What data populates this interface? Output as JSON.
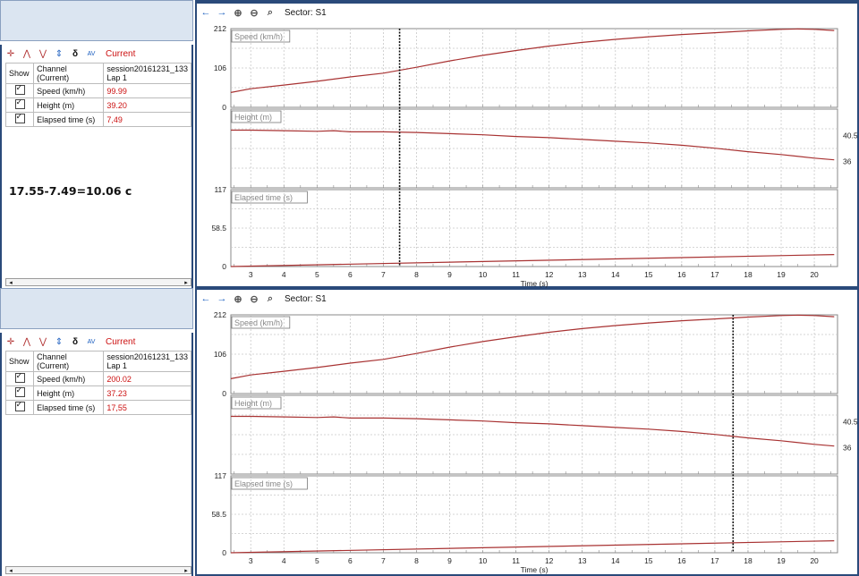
{
  "panels": [
    {
      "toolbar": {
        "current_label": "Current"
      },
      "table": {
        "header_show": "Show",
        "header_channel": "Channel\n(Current)",
        "header_session": "session20161231_133\nLap 1",
        "rows": [
          {
            "channel": "Speed (km/h)",
            "value": "99.99"
          },
          {
            "channel": "Height (m)",
            "value": "39.20"
          },
          {
            "channel": "Elapsed time (s)",
            "value": "7,49"
          }
        ]
      },
      "note": "17.55-7.49=10.06 c",
      "sector": "Sector: S1",
      "cursor_time": 7.49
    },
    {
      "toolbar": {
        "current_label": "Current"
      },
      "table": {
        "header_show": "Show",
        "header_channel": "Channel\n(Current)",
        "header_session": "session20161231_133\nLap 1",
        "rows": [
          {
            "channel": "Speed (km/h)",
            "value": "200.02"
          },
          {
            "channel": "Height (m)",
            "value": "37.23"
          },
          {
            "channel": "Elapsed time (s)",
            "value": "17,55"
          }
        ]
      },
      "note": "",
      "sector": "Sector: S1",
      "cursor_time": 17.55
    }
  ],
  "chart_data": {
    "type": "line",
    "xlabel": "Time (s)",
    "xlim": [
      2.4,
      20.7
    ],
    "x_ticks": [
      3,
      4,
      5,
      6,
      7,
      8,
      9,
      10,
      11,
      12,
      13,
      14,
      15,
      16,
      17,
      18,
      19,
      20
    ],
    "subplots": [
      {
        "label": "Speed (km/h)",
        "yticks": [
          "212",
          "106",
          "0"
        ],
        "ylim": [
          0,
          212
        ],
        "x": [
          2.4,
          3,
          4,
          5,
          6,
          7,
          8,
          9,
          10,
          11,
          12,
          13,
          14,
          15,
          16,
          17,
          18,
          19,
          19.5,
          20,
          20.6
        ],
        "y": [
          40,
          50,
          60,
          70,
          82,
          92,
          108,
          125,
          140,
          153,
          165,
          175,
          183,
          190,
          196,
          201,
          206,
          210,
          211,
          210,
          207
        ]
      },
      {
        "label": "Height (m)",
        "yticks_right": [
          "40.5",
          "36"
        ],
        "ylim": [
          31.5,
          45
        ],
        "x": [
          2.4,
          3,
          4,
          5,
          5.5,
          6,
          7,
          8,
          9,
          10,
          11,
          12,
          13,
          14,
          15,
          16,
          17,
          18,
          19,
          20,
          20.6
        ],
        "y": [
          41.4,
          41.4,
          41.3,
          41.2,
          41.3,
          41.1,
          41.1,
          41.0,
          40.8,
          40.6,
          40.3,
          40.1,
          39.8,
          39.5,
          39.2,
          38.8,
          38.3,
          37.7,
          37.2,
          36.6,
          36.3
        ]
      },
      {
        "label": "Elapsed time (s)",
        "yticks": [
          "117",
          "58.5",
          "0"
        ],
        "ylim": [
          0,
          117
        ],
        "x": [
          2.4,
          20.6
        ],
        "y": [
          0,
          18.2
        ]
      }
    ]
  },
  "colors": {
    "trace": "#a83232",
    "accent": "#1e60c0",
    "border": "#2a4a7a"
  }
}
